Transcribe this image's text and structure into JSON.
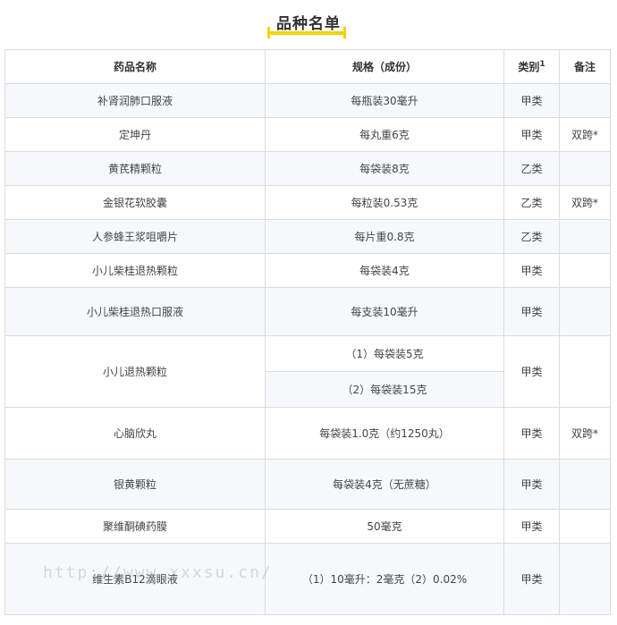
{
  "title": "品种名单",
  "table": {
    "headers": {
      "name": "药品名称",
      "spec": "规格（成份）",
      "category": "类别",
      "category_footnote": "1",
      "note": "备注"
    },
    "rows": [
      {
        "name": "补肾润肺口服液",
        "spec": "每瓶装30毫升",
        "category": "甲类",
        "note": ""
      },
      {
        "name": "定坤丹",
        "spec": "每丸重6克",
        "category": "甲类",
        "note": "双跨*"
      },
      {
        "name": "黄芪精颗粒",
        "spec": "每袋装8克",
        "category": "乙类",
        "note": ""
      },
      {
        "name": "金银花软胶囊",
        "spec": "每粒装0.53克",
        "category": "乙类",
        "note": "双跨*"
      },
      {
        "name": "人参蜂王浆咀嚼片",
        "spec": "每片重0.8克",
        "category": "乙类",
        "note": ""
      },
      {
        "name": "小儿柴桂退热颗粒",
        "spec": "每袋装4克",
        "category": "甲类",
        "note": ""
      },
      {
        "name": "小儿柴桂退热口服液",
        "spec": "每支装10毫升",
        "category": "甲类",
        "note": ""
      },
      {
        "name": "小儿退热颗粒",
        "spec": "（1）每袋装5克",
        "spec2": "（2）每袋装15克",
        "category": "甲类",
        "note": ""
      },
      {
        "name": "心脑欣丸",
        "spec": "每袋装1.0克（约1250丸）",
        "category": "甲类",
        "note": "双跨*"
      },
      {
        "name": "银黄颗粒",
        "spec": "每袋装4克（无蔗糖）",
        "category": "甲类",
        "note": ""
      },
      {
        "name": "聚维酮碘药膜",
        "spec": "50毫克",
        "category": "甲类",
        "note": ""
      },
      {
        "name": "维生素B12滴眼液",
        "spec": "（1）10毫升：2毫克（2）0.02%",
        "category": "甲类",
        "note": ""
      }
    ]
  },
  "watermark": "http://www.xxxsu.cn/"
}
